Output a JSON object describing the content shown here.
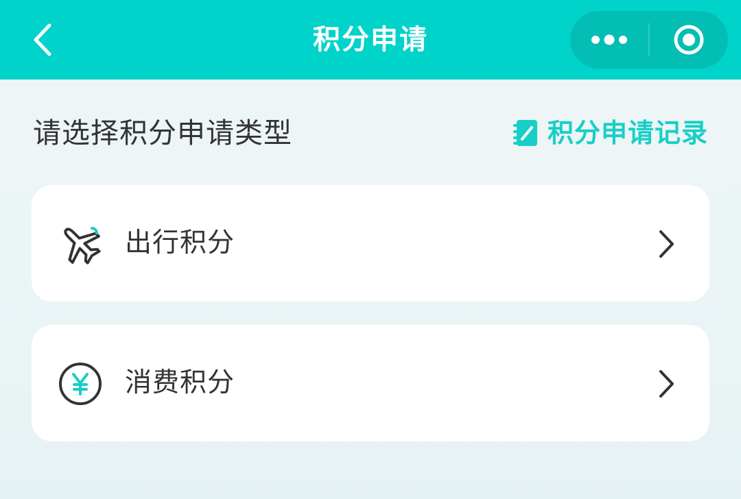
{
  "nav": {
    "title": "积分申请",
    "back_icon": "chevron-left-icon",
    "more_icon": "more-dots-icon",
    "close_icon": "target-circle-icon"
  },
  "section": {
    "title": "请选择积分申请类型",
    "records_link_label": "积分申请记录",
    "records_icon": "notebook-edit-icon"
  },
  "cards": [
    {
      "label": "出行积分",
      "icon": "airplane-icon"
    },
    {
      "label": "消费积分",
      "icon": "yen-circle-icon"
    }
  ],
  "colors": {
    "brand": "#00d3c9",
    "brand_dark": "#02beb4",
    "accent_text": "#18cfc6",
    "text_primary": "#333333",
    "page_bg": "#eef5f8",
    "card_bg": "#ffffff"
  }
}
